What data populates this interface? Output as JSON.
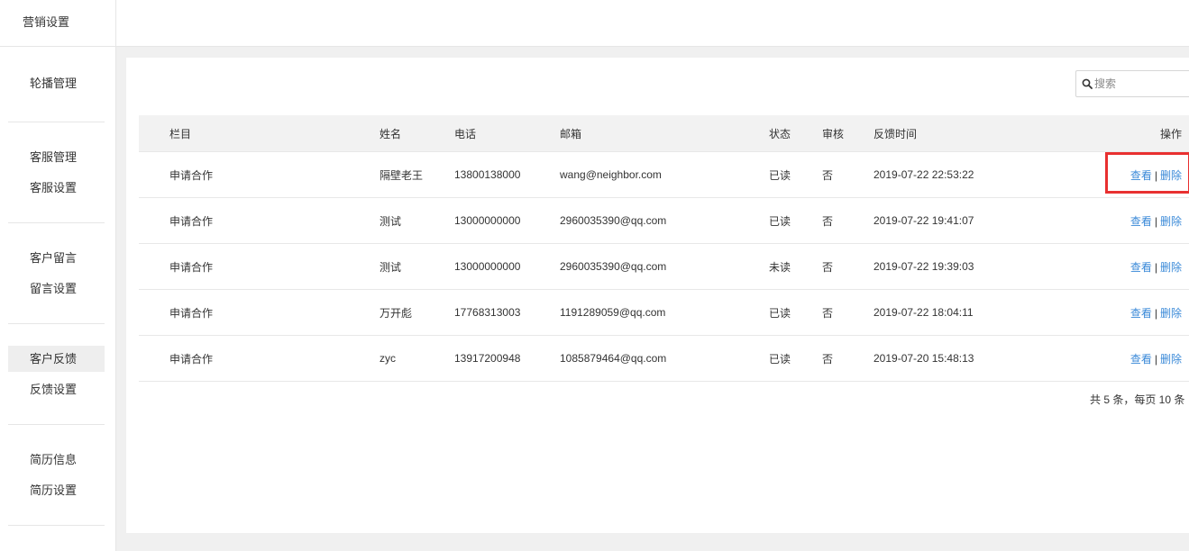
{
  "sidebar": {
    "title": "营销设置",
    "groups": [
      [
        "轮播管理"
      ],
      [
        "客服管理",
        "客服设置"
      ],
      [
        "客户留言",
        "留言设置"
      ],
      [
        "客户反馈",
        "反馈设置"
      ],
      [
        "简历信息",
        "简历设置"
      ]
    ],
    "active": "客户反馈"
  },
  "search": {
    "placeholder": "搜索"
  },
  "table": {
    "headers": [
      "栏目",
      "姓名",
      "电话",
      "邮箱",
      "状态",
      "审核",
      "反馈时间",
      "操作"
    ],
    "rows": [
      [
        "申请合作",
        "隔壁老王",
        "13800138000",
        "wang@neighbor.com",
        "已读",
        "否",
        "2019-07-22 22:53:22"
      ],
      [
        "申请合作",
        "测试",
        "13000000000",
        "2960035390@qq.com",
        "已读",
        "否",
        "2019-07-22 19:41:07"
      ],
      [
        "申请合作",
        "测试",
        "13000000000",
        "2960035390@qq.com",
        "未读",
        "否",
        "2019-07-22 19:39:03"
      ],
      [
        "申请合作",
        "万开彪",
        "17768313003",
        "1191289059@qq.com",
        "已读",
        "否",
        "2019-07-22 18:04:11"
      ],
      [
        "申请合作",
        "zyc",
        "13917200948",
        "1085879464@qq.com",
        "已读",
        "否",
        "2019-07-20 15:48:13"
      ]
    ],
    "actions": {
      "view": "查看",
      "delete": "删除",
      "separator": "|"
    }
  },
  "pager": {
    "text": "共 5 条，每页 10 条"
  },
  "colors": {
    "link": "#3b8ad8",
    "highlight": "#e83030",
    "header_bg": "#f2f2f2"
  }
}
